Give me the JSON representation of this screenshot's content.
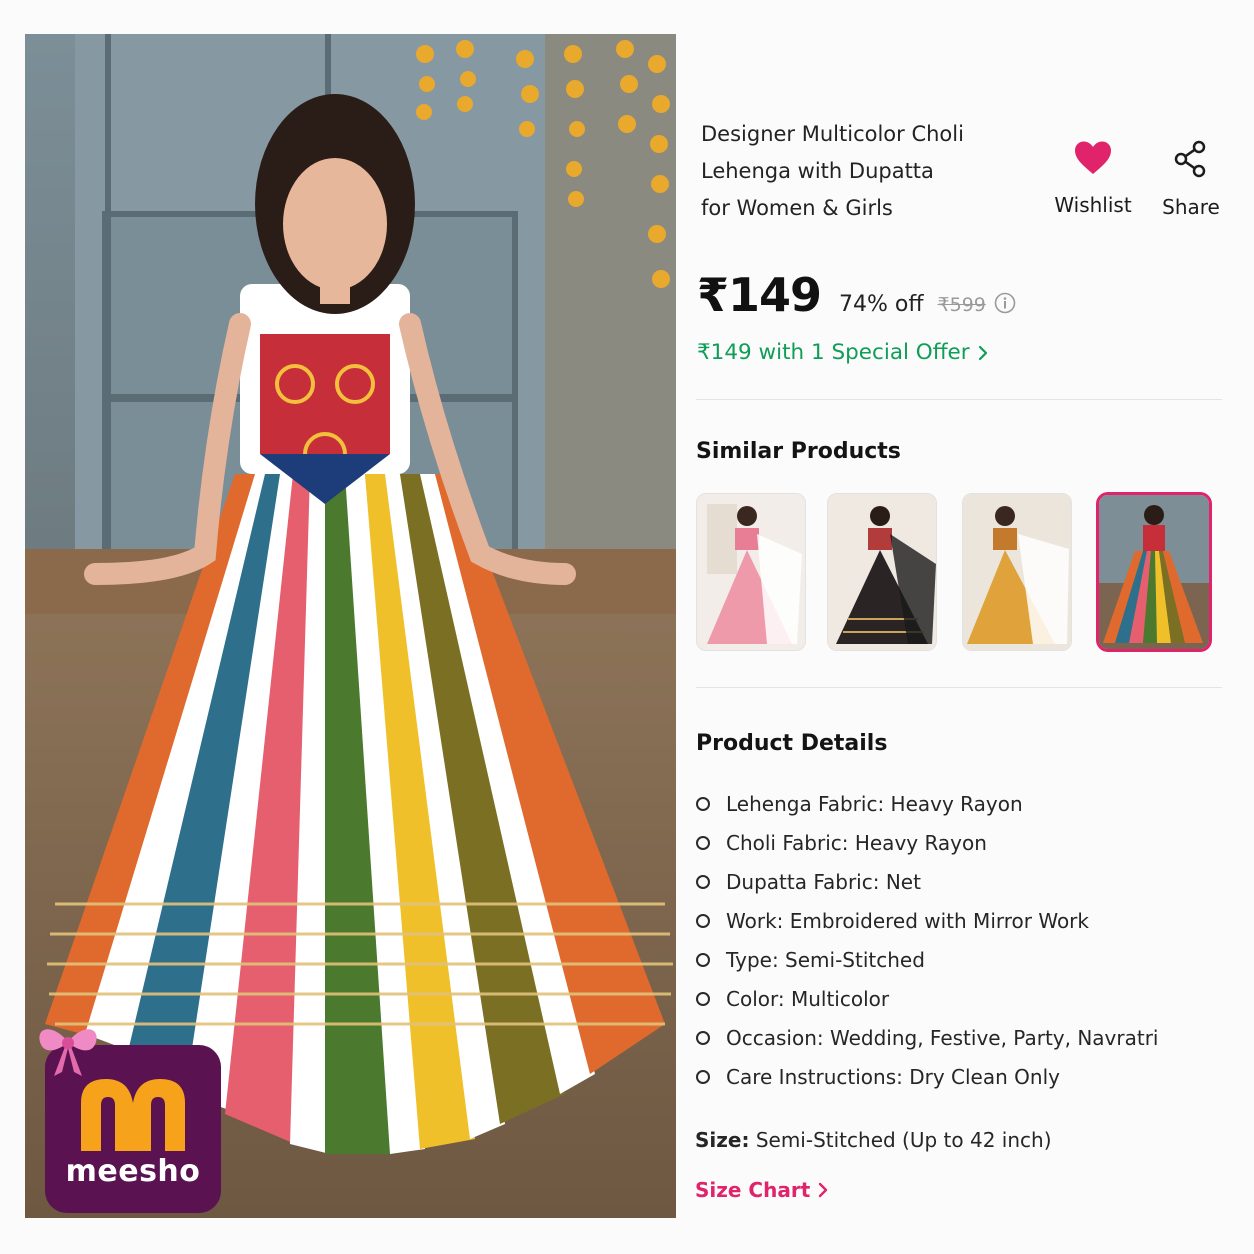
{
  "product": {
    "title_lines": [
      "Designer Multicolor Choli",
      "Lehenga with Dupatta",
      "for Women & Girls"
    ],
    "price": "₹149",
    "discount": "74% off",
    "mrp": "₹599",
    "offer_text": "₹149 with 1 Special Offer"
  },
  "actions": {
    "wishlist_label": "Wishlist",
    "share_label": "Share"
  },
  "brand": {
    "name": "meesho"
  },
  "similar": {
    "title": "Similar Products",
    "items": [
      {
        "variant": "pink"
      },
      {
        "variant": "black"
      },
      {
        "variant": "mustard"
      },
      {
        "variant": "multicolor",
        "selected": true
      }
    ]
  },
  "details": {
    "title": "Product Details",
    "items": [
      "Lehenga Fabric: Heavy Rayon",
      "Choli Fabric: Heavy Rayon",
      "Dupatta Fabric: Net",
      "Work: Embroidered with Mirror Work",
      "Type: Semi-Stitched",
      "Color: Multicolor",
      "Occasion: Wedding, Festive, Party, Navratri",
      "Care Instructions: Dry Clean Only"
    ]
  },
  "size": {
    "label": "Size:",
    "value": "Semi-Stitched (Up to 42 inch)",
    "chart_link": "Size Chart"
  },
  "colors": {
    "accent": "#e0236a",
    "offer_green": "#0f9d58",
    "brand_purple": "#5a1250",
    "brand_orange": "#f6a31b"
  },
  "icons": {
    "wishlist": "heart-icon",
    "share": "share-icon",
    "info": "info-icon",
    "chevron": "chevron-right-icon"
  }
}
